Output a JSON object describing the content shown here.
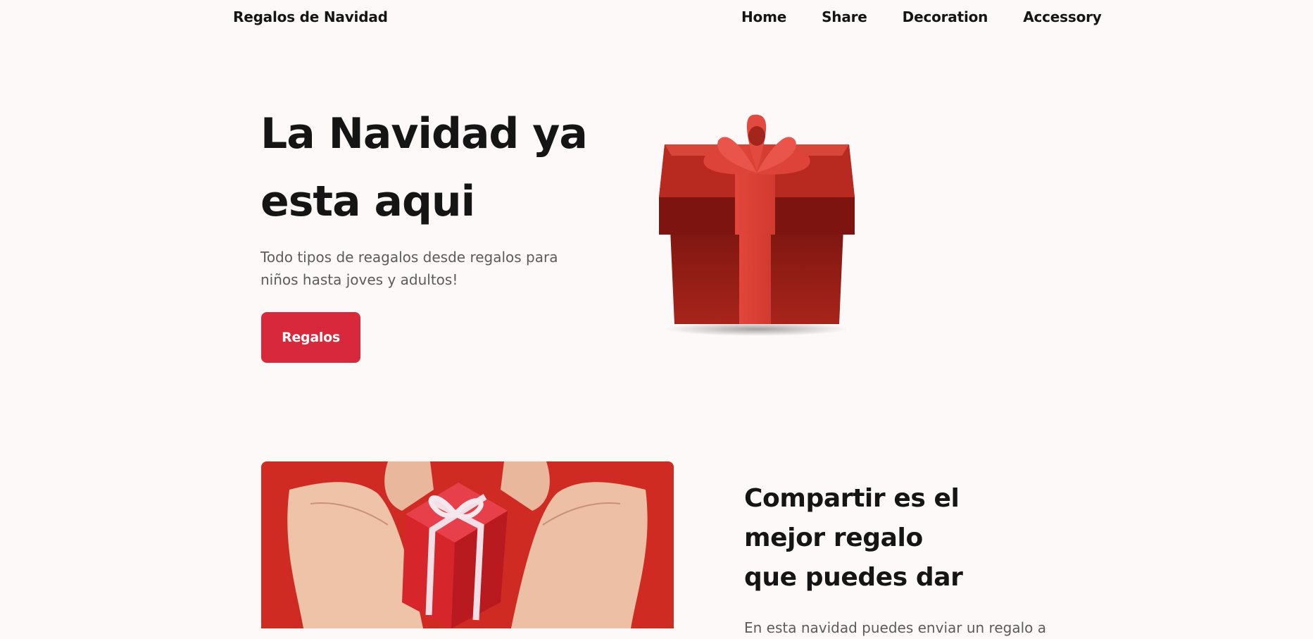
{
  "header": {
    "brand": "Regalos de Navidad",
    "nav": [
      "Home",
      "Share",
      "Decoration",
      "Accessory"
    ]
  },
  "hero": {
    "title": "La Navidad ya esta aqui",
    "subtitle": "Todo tipos de reagalos desde regalos para niños hasta joves y adultos!",
    "button_label": "Regalos"
  },
  "share": {
    "title_line1": "Compartir es el mejor regalo",
    "title_line2": "que puedes dar",
    "text": "En esta navidad puedes enviar un regalo a"
  },
  "colors": {
    "accent": "#d8283b",
    "background": "#fdf9f8",
    "gift_red": "#b3221a",
    "ribbon": "#e8473a"
  }
}
